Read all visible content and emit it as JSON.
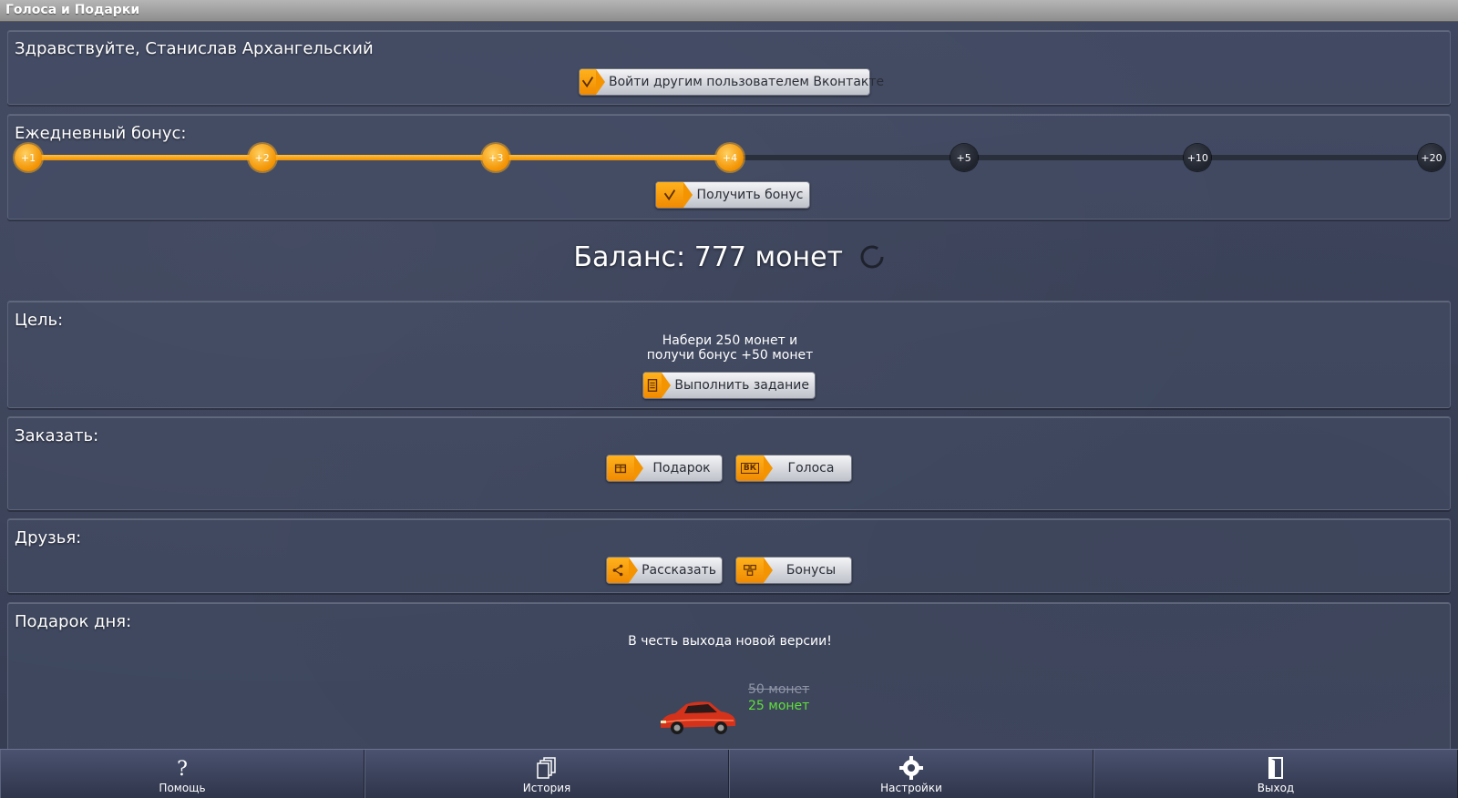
{
  "window": {
    "title": "Голоса и Подарки"
  },
  "greeting": {
    "text": "Здравствуйте, Станислав Архангельский",
    "switch_user_label": "Войти другим пользователем Вконтакте",
    "switch_user_icon": "check-icon"
  },
  "daily_bonus": {
    "title": "Ежедневный бонус:",
    "steps": [
      "+1",
      "+2",
      "+3",
      "+4",
      "+5",
      "+10",
      "+20"
    ],
    "completed_steps": 4,
    "claim_label": "Получить бонус",
    "claim_icon": "check-icon"
  },
  "balance": {
    "text": "Баланс: 777 монет",
    "refresh_icon": "refresh-icon"
  },
  "goal": {
    "title": "Цель:",
    "line1": "Набери 250 монет и",
    "line2": "получи бонус +50 монет",
    "action_label": "Выполнить задание",
    "action_icon": "task-list-icon"
  },
  "order": {
    "title": "Заказать:",
    "gift_label": "Подарок",
    "gift_icon": "gift-box-icon",
    "votes_label": "Голоса",
    "votes_icon": "vk-icon",
    "votes_icon_text": "ВК"
  },
  "friends": {
    "title": "Друзья:",
    "share_label": "Рассказать",
    "share_icon": "share-icon",
    "bonuses_label": "Бонусы",
    "bonuses_icon": "people-icon"
  },
  "gift_of_day": {
    "title": "Подарок дня:",
    "subtitle": "В честь выхода новой версии!",
    "old_price": "50 монет",
    "new_price": "25 монет",
    "image": "red-sports-car"
  },
  "tabbar": {
    "items": [
      {
        "label": "Помощь",
        "icon": "question-icon"
      },
      {
        "label": "История",
        "icon": "history-icon"
      },
      {
        "label": "Настройки",
        "icon": "gear-icon"
      },
      {
        "label": "Выход",
        "icon": "exit-door-icon"
      }
    ]
  },
  "colors": {
    "accent": "#f39400",
    "background": "#3a4158",
    "new_price": "#5fe03a"
  }
}
